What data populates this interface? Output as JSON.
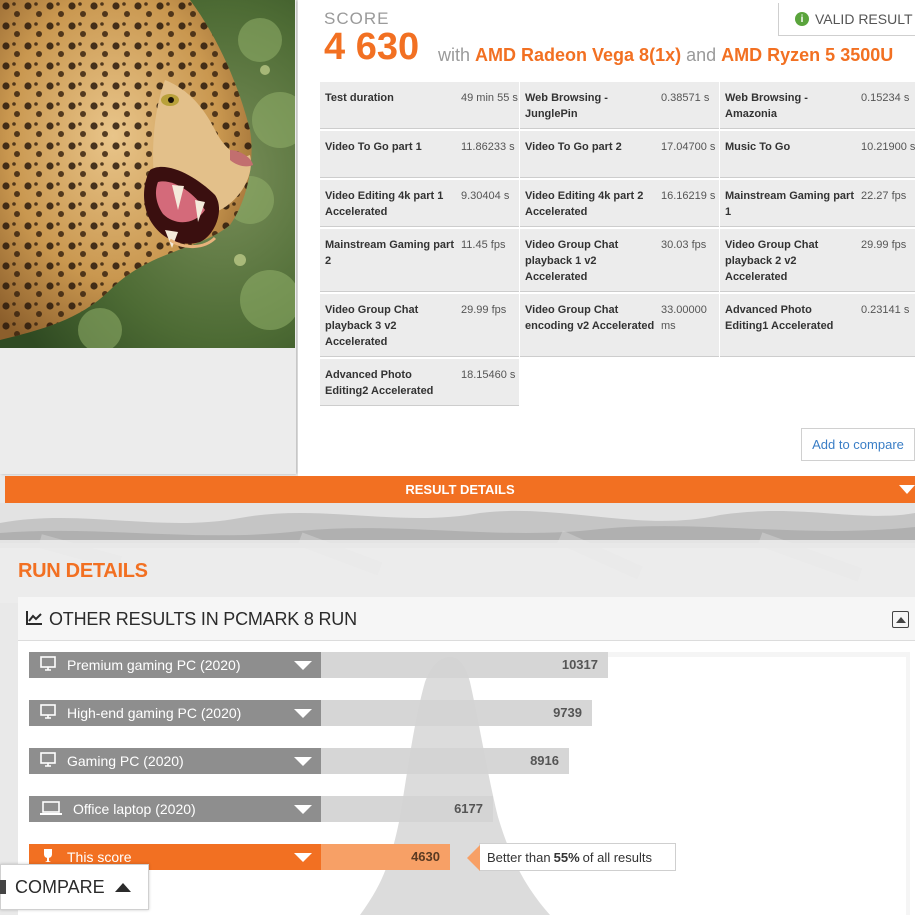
{
  "header": {
    "score_label": "SCORE",
    "score_value": "4 630",
    "with_text": "with",
    "gpu": "AMD Radeon Vega 8(1x)",
    "and_text": "and",
    "cpu": "AMD Ryzen 5 3500U",
    "valid_badge": "VALID RESULT",
    "valid_icon": "info-icon"
  },
  "results": [
    {
      "name": "Test duration",
      "value": "49 min 55 s"
    },
    {
      "name": "Web Browsing - JunglePin",
      "value": "0.38571 s"
    },
    {
      "name": "Web Browsing - Amazonia",
      "value": "0.15234 s"
    },
    {
      "name": "Video To Go part 1",
      "value": "11.86233 s"
    },
    {
      "name": "Video To Go part 2",
      "value": "17.04700 s"
    },
    {
      "name": "Music To Go",
      "value": "10.21900 s"
    },
    {
      "name": "Video Editing 4k part 1 Accelerated",
      "value": "9.30404 s"
    },
    {
      "name": "Video Editing 4k part 2 Accelerated",
      "value": "16.16219 s"
    },
    {
      "name": "Mainstream Gaming part 1",
      "value": "22.27 fps"
    },
    {
      "name": "Mainstream Gaming part 2",
      "value": "11.45 fps"
    },
    {
      "name": "Video Group Chat playback 1 v2 Accelerated",
      "value": "30.03 fps"
    },
    {
      "name": "Video Group Chat playback 2 v2 Accelerated",
      "value": "29.99 fps"
    },
    {
      "name": "Video Group Chat playback 3 v2 Accelerated",
      "value": "29.99 fps"
    },
    {
      "name": "Video Group Chat encoding v2 Accelerated",
      "value": "33.00000 ms"
    },
    {
      "name": "Advanced Photo Editing1 Accelerated",
      "value": "0.23141 s"
    },
    {
      "name": "Advanced Photo Editing2 Accelerated",
      "value": "18.15460 s"
    }
  ],
  "add_to_compare": "Add to compare",
  "result_details": "RESULT DETAILS",
  "run_details": "RUN DETAILS",
  "panel": {
    "title": "OTHER RESULTS IN PCMARK 8 RUN",
    "title_icon": "line-chart-icon",
    "collapse_icon": "collapse-icon"
  },
  "comparison": {
    "rows": [
      {
        "label": "Premium gaming PC (2020)",
        "icon": "desktop-icon",
        "value": "10317",
        "score": 10317
      },
      {
        "label": "High-end gaming PC (2020)",
        "icon": "desktop-icon",
        "value": "9739",
        "score": 9739
      },
      {
        "label": "Gaming PC (2020)",
        "icon": "desktop-icon",
        "value": "8916",
        "score": 8916
      },
      {
        "label": "Office laptop (2020)",
        "icon": "laptop-icon",
        "value": "6177",
        "score": 6177
      },
      {
        "label": "This score",
        "icon": "trophy-icon",
        "value": "4630",
        "score": 4630
      }
    ],
    "tooltip_prefix": "Better than",
    "tooltip_percent": "55%",
    "tooltip_suffix": "of all results"
  },
  "compare_button": {
    "label": "COMPARE",
    "icon": "chevron-up-icon"
  },
  "colors": {
    "accent": "#f27022",
    "valid": "#5aa43c",
    "link": "#3a7ec6",
    "row_gray": "#8e8e8e"
  }
}
